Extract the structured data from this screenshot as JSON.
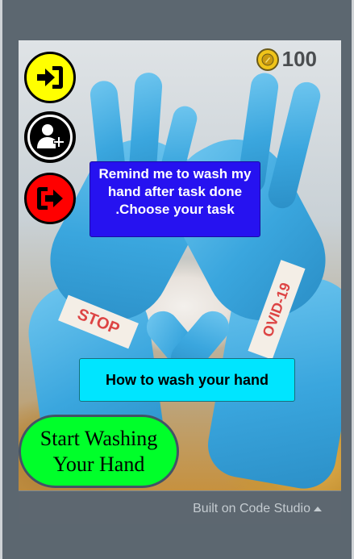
{
  "coins": {
    "count": "100",
    "icon": "coin-icon"
  },
  "buttons": {
    "signin_icon": "sign-in-icon",
    "adduser_icon": "add-user-icon",
    "signout_icon": "sign-out-icon"
  },
  "remind": {
    "label": "Remind me to wash my hand after task done .Choose your task"
  },
  "howto": {
    "label": "How to wash your hand"
  },
  "start": {
    "label": "Start Washing Your Hand"
  },
  "photo": {
    "tape_left": "STOP",
    "tape_right": "OVID-19"
  },
  "footer": {
    "label": "Built on Code Studio"
  },
  "colors": {
    "remind_bg": "#2612f0",
    "howto_bg": "#00e5ff",
    "start_bg": "#00ff2a",
    "signin_bg": "#ffff00",
    "signout_bg": "#ff0000",
    "adduser_bg": "#000000"
  }
}
